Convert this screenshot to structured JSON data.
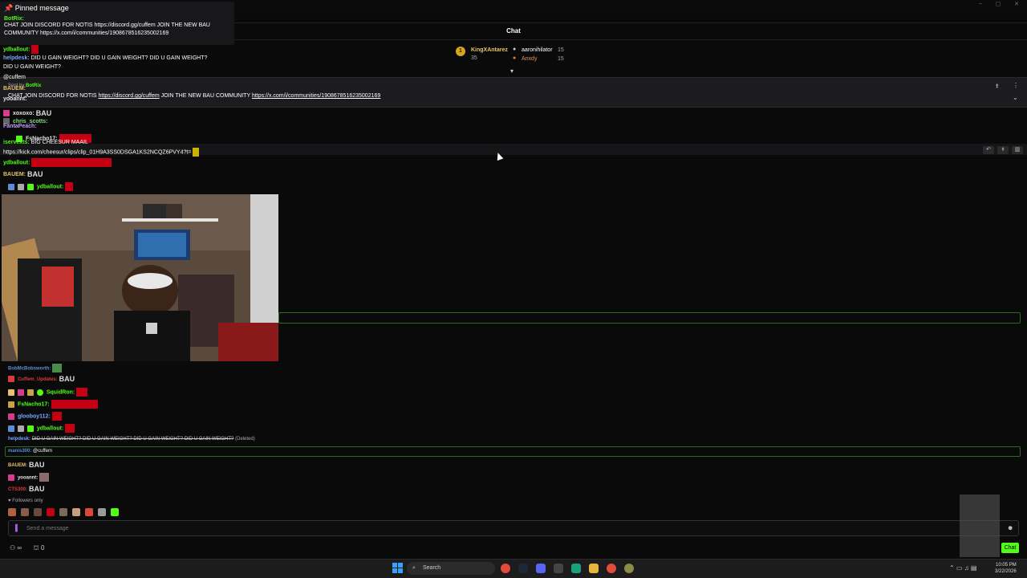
{
  "window": {
    "minimize": "–",
    "maximize": "▢",
    "close": "✕"
  },
  "chat_header": {
    "title": "Chat"
  },
  "pinned_popup": {
    "heading": "Pinned message",
    "user": "BotRix:",
    "message": "CHAT JOIN DISCORD FOR NOTIS https://discord.gg/cuffem JOIN THE NEW BAU COMMUNITY https://x.com/i/communities/1908678516235002169"
  },
  "top_gifters": [
    {
      "rank": "1",
      "name": "KingXAntarez",
      "count": "35"
    },
    {
      "name": "aaronihilator",
      "count": "15"
    },
    {
      "name": "Anxdy",
      "count": "15"
    }
  ],
  "pinned_bar": {
    "sender_label": "Sent by",
    "sender": "BotRix",
    "text_prefix": "CHAT JOIN DISCORD FOR NOTIS",
    "link1": "https://discord.gg/cuffem",
    "text_middle": "JOIN THE NEW BAU COMMUNITY",
    "link2": "https://x.com/i/communities/1908678516235002169"
  },
  "messages_top": [
    {
      "user": "ydballout:",
      "color": "#53fc18",
      "text": ""
    },
    {
      "user": "helpdesk:",
      "color": "#7aa6ff",
      "text": "DID U GAIN WEIGHT?  DID U GAIN WEIGHT?  DID U GAIN WEIGHT?"
    },
    {
      "user": "",
      "color": "#fff",
      "text": "DID U GAIN WEIGHT?"
    },
    {
      "user": "@cuffem",
      "color": "#fff",
      "text": ""
    },
    {
      "user": "BAUEM:",
      "color": "#e6c36a",
      "text": ""
    },
    {
      "user": "yooannt:",
      "color": "#e6e6e6",
      "text": ""
    },
    {
      "user": "xoxoxo:",
      "color": "#e6e6e6",
      "text": "BAU"
    },
    {
      "user": "chris_scotts:",
      "color": "#7de07d",
      "text": ""
    },
    {
      "user": "FantaPeach:",
      "color": "#c79bff",
      "text": ""
    },
    {
      "user": "FsNacho17:",
      "color": "#e6e6e6",
      "text": ""
    },
    {
      "user": "iservexts:",
      "color": "#53fc18",
      "text": "BIG CHEESUR MAAIL"
    },
    {
      "user": "",
      "color": "#fff",
      "text": "https://kick.com/cheesur/clips/clip_01H9A3SS0DSGA1KS2NCQZ6PVY4?t="
    },
    {
      "user": "ydballout:",
      "color": "#53fc18",
      "text": ""
    },
    {
      "user": "BAUEM:",
      "color": "#e6c36a",
      "text": "BAU"
    },
    {
      "user": "ydballout:",
      "color": "#53fc18",
      "text": ""
    }
  ],
  "messages_bottom": [
    {
      "user": "BobMcBobsworth:",
      "color": "#5c8dd6",
      "text": ""
    },
    {
      "user": "Cuffem_Updates:",
      "color": "#d93b3b",
      "text": "BAU"
    },
    {
      "user": "SquidRon:",
      "color": "#53fc18",
      "text": ""
    },
    {
      "user": "FsNacho17:",
      "color": "#53fc18",
      "text": ""
    },
    {
      "user": "glooboy112:",
      "color": "#7aa6ff",
      "text": ""
    },
    {
      "user": "ydballout:",
      "color": "#53fc18",
      "text": ""
    },
    {
      "user": "helpdesk:",
      "color": "#7aa6ff",
      "text": "DID U GAIN WEIGHT?  DID U GAIN WEIGHT?  DID U GAIN WEIGHT?  DID U GAIN WEIGHT?",
      "deleted": "(Deleted)"
    },
    {
      "user": "manis300:",
      "color": "#5c8dd6",
      "text": "@cuffem"
    },
    {
      "user": "BAUEM:",
      "color": "#e6c36a",
      "text": "BAU"
    },
    {
      "user": "yooannt:",
      "color": "#e6e6e6",
      "text": ""
    },
    {
      "user": "CTS300:",
      "color": "#d93b3b",
      "text": "BAU"
    }
  ],
  "footer": {
    "followers_only": "Followers only",
    "input_placeholder": "Send a message",
    "chat_button": "Chat",
    "infinity": "∞",
    "count": "0"
  },
  "taskbar": {
    "search": "Search",
    "time": "10:05 PM",
    "date": "3/22/2026"
  }
}
